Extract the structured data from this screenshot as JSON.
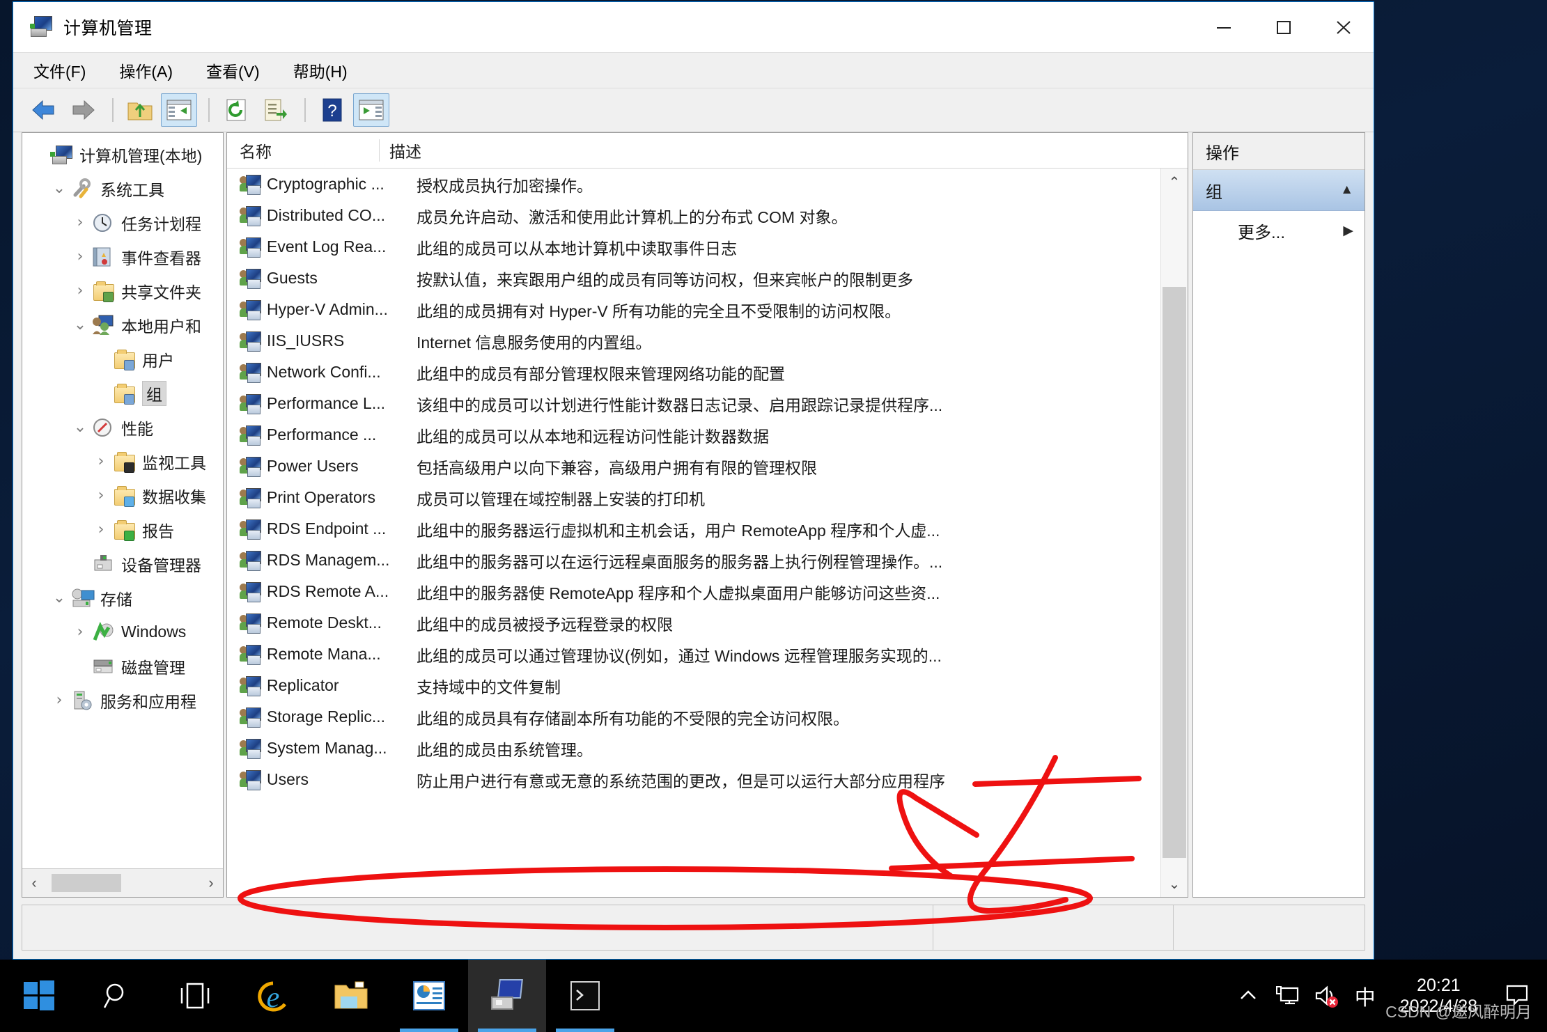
{
  "window": {
    "title": "计算机管理",
    "title_icon": "computer-management-icon",
    "controls": {
      "minimize": "–",
      "maximize": "□",
      "close": "✕"
    }
  },
  "menubar": [
    {
      "label": "文件(F)",
      "name": "menu-file"
    },
    {
      "label": "操作(A)",
      "name": "menu-action"
    },
    {
      "label": "查看(V)",
      "name": "menu-view"
    },
    {
      "label": "帮助(H)",
      "name": "menu-help"
    }
  ],
  "toolbar": [
    {
      "name": "back-button",
      "icon": "back-arrow-icon",
      "active": false
    },
    {
      "name": "forward-button",
      "icon": "forward-arrow-icon",
      "active": false
    },
    {
      "name": "up-one-level-button",
      "icon": "folder-up-icon",
      "active": false
    },
    {
      "name": "show-hide-console-tree-button",
      "icon": "console-tree-icon",
      "active": true
    },
    {
      "name": "refresh-button",
      "icon": "refresh-icon",
      "active": false
    },
    {
      "name": "export-list-button",
      "icon": "export-list-icon",
      "active": false
    },
    {
      "name": "help-button",
      "icon": "help-question-icon",
      "active": false
    },
    {
      "name": "show-hide-action-pane-button",
      "icon": "action-pane-icon",
      "active": true
    }
  ],
  "tree": {
    "items": [
      {
        "label": "计算机管理(本地)",
        "indent": 0,
        "twisty": "",
        "icon": "computer-management-icon",
        "selected": false
      },
      {
        "label": "系统工具",
        "indent": 1,
        "twisty": "⌄",
        "icon": "system-tools-icon",
        "selected": false
      },
      {
        "label": "任务计划程",
        "indent": 2,
        "twisty": "›",
        "icon": "task-scheduler-icon",
        "selected": false
      },
      {
        "label": "事件查看器",
        "indent": 2,
        "twisty": "›",
        "icon": "event-viewer-icon",
        "selected": false
      },
      {
        "label": "共享文件夹",
        "indent": 2,
        "twisty": "›",
        "icon": "shared-folders-icon",
        "selected": false
      },
      {
        "label": "本地用户和",
        "indent": 2,
        "twisty": "⌄",
        "icon": "local-users-groups-icon",
        "selected": false
      },
      {
        "label": "用户",
        "indent": 3,
        "twisty": "",
        "icon": "folder-users-icon",
        "selected": false
      },
      {
        "label": "组",
        "indent": 3,
        "twisty": "",
        "icon": "folder-groups-icon",
        "selected": true
      },
      {
        "label": "性能",
        "indent": 2,
        "twisty": "⌄",
        "icon": "performance-icon",
        "selected": false
      },
      {
        "label": "监视工具",
        "indent": 3,
        "twisty": "›",
        "icon": "monitoring-tools-icon",
        "selected": false
      },
      {
        "label": "数据收集",
        "indent": 3,
        "twisty": "›",
        "icon": "data-collector-icon",
        "selected": false
      },
      {
        "label": "报告",
        "indent": 3,
        "twisty": "›",
        "icon": "reports-icon",
        "selected": false
      },
      {
        "label": "设备管理器",
        "indent": 2,
        "twisty": "",
        "icon": "device-manager-icon",
        "selected": false
      },
      {
        "label": "存储",
        "indent": 1,
        "twisty": "⌄",
        "icon": "storage-icon",
        "selected": false
      },
      {
        "label": "Windows",
        "indent": 2,
        "twisty": "›",
        "icon": "windows-backup-icon",
        "selected": false
      },
      {
        "label": "磁盘管理",
        "indent": 2,
        "twisty": "",
        "icon": "disk-management-icon",
        "selected": false
      },
      {
        "label": "服务和应用程",
        "indent": 1,
        "twisty": "›",
        "icon": "services-applications-icon",
        "selected": false
      }
    ]
  },
  "list": {
    "columns": [
      "名称",
      "描述"
    ],
    "rows": [
      {
        "name": "Cryptographic ...",
        "desc": "授权成员执行加密操作。"
      },
      {
        "name": "Distributed CO...",
        "desc": "成员允许启动、激活和使用此计算机上的分布式 COM 对象。"
      },
      {
        "name": "Event Log Rea...",
        "desc": "此组的成员可以从本地计算机中读取事件日志"
      },
      {
        "name": "Guests",
        "desc": "按默认值，来宾跟用户组的成员有同等访问权，但来宾帐户的限制更多"
      },
      {
        "name": "Hyper-V Admin...",
        "desc": "此组的成员拥有对 Hyper-V 所有功能的完全且不受限制的访问权限。"
      },
      {
        "name": "IIS_IUSRS",
        "desc": "Internet 信息服务使用的内置组。"
      },
      {
        "name": "Network Confi...",
        "desc": "此组中的成员有部分管理权限来管理网络功能的配置"
      },
      {
        "name": "Performance L...",
        "desc": "该组中的成员可以计划进行性能计数器日志记录、启用跟踪记录提供程序..."
      },
      {
        "name": "Performance ...",
        "desc": "此组的成员可以从本地和远程访问性能计数器数据"
      },
      {
        "name": "Power Users",
        "desc": "包括高级用户以向下兼容，高级用户拥有有限的管理权限"
      },
      {
        "name": "Print Operators",
        "desc": "成员可以管理在域控制器上安装的打印机"
      },
      {
        "name": "RDS Endpoint ...",
        "desc": "此组中的服务器运行虚拟机和主机会话，用户 RemoteApp 程序和个人虚..."
      },
      {
        "name": "RDS Managem...",
        "desc": "此组中的服务器可以在运行远程桌面服务的服务器上执行例程管理操作。..."
      },
      {
        "name": "RDS Remote A...",
        "desc": "此组中的服务器使 RemoteApp 程序和个人虚拟桌面用户能够访问这些资..."
      },
      {
        "name": "Remote Deskt...",
        "desc": "此组中的成员被授予远程登录的权限"
      },
      {
        "name": "Remote Mana...",
        "desc": "此组的成员可以通过管理协议(例如，通过 Windows 远程管理服务实现的..."
      },
      {
        "name": "Replicator",
        "desc": "支持域中的文件复制"
      },
      {
        "name": "Storage Replic...",
        "desc": "此组的成员具有存储副本所有功能的不受限的完全访问权限。"
      },
      {
        "name": "System Manag...",
        "desc": "此组的成员由系统管理。"
      },
      {
        "name": "Users",
        "desc": "防止用户进行有意或无意的系统范围的更改，但是可以运行大部分应用程序"
      }
    ]
  },
  "action_pane": {
    "header": "操作",
    "group": {
      "label": "组",
      "collapse_icon": "caret-up-icon"
    },
    "items": [
      {
        "label": "更多...",
        "submenu_icon": "caret-right-icon"
      }
    ]
  },
  "statusbar": {
    "left": "",
    "middle": "",
    "right": ""
  },
  "taskbar": {
    "start": "windows-logo-icon",
    "buttons": [
      {
        "name": "search-icon",
        "running": false
      },
      {
        "name": "task-view-icon",
        "running": false
      },
      {
        "name": "internet-explorer-icon",
        "running": false
      },
      {
        "name": "file-explorer-icon",
        "running": false
      },
      {
        "name": "powerpoint-icon",
        "running": true
      },
      {
        "name": "computer-management-icon",
        "running": true
      },
      {
        "name": "command-prompt-icon",
        "running": true
      }
    ],
    "tray": [
      {
        "name": "show-hidden-icons-icon",
        "glyph": "⌃"
      },
      {
        "name": "network-icon",
        "glyph": ""
      },
      {
        "name": "volume-muted-icon",
        "glyph": ""
      },
      {
        "name": "ime-chinese-icon",
        "glyph": "中"
      }
    ],
    "clock": {
      "time": "20:21",
      "date": "2022/4/28"
    },
    "action_center_icon": "action-center-icon"
  },
  "watermark": "CSDN @邀风醉明月",
  "colors": {
    "accent": "#0078d7",
    "window_bg": "#f0f0f0",
    "selection": "#cfe0f2",
    "annotation_red": "#ee1111",
    "taskbar": "#000000"
  }
}
